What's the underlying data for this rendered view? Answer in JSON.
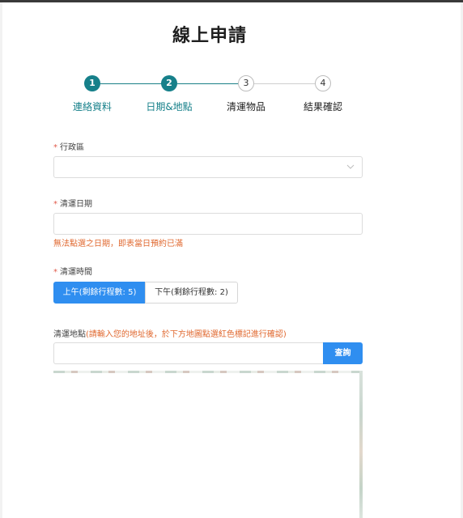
{
  "page": {
    "title": "線上申請"
  },
  "steps": [
    {
      "num": "1",
      "label": "連絡資料",
      "state": "done"
    },
    {
      "num": "2",
      "label": "日期&地點",
      "state": "done"
    },
    {
      "num": "3",
      "label": "清運物品",
      "state": "todo"
    },
    {
      "num": "4",
      "label": "結果確認",
      "state": "todo"
    }
  ],
  "form": {
    "district": {
      "label": "行政區",
      "required_mark": "*",
      "value": ""
    },
    "date": {
      "label": "清運日期",
      "required_mark": "*",
      "value": "",
      "error": "無法點選之日期，即表當日預約已滿"
    },
    "time": {
      "label": "清運時間",
      "required_mark": "*",
      "options": [
        {
          "label": "上午(剩餘行程數: 5)",
          "selected": true
        },
        {
          "label": "下午(剩餘行程數: 2)",
          "selected": false
        }
      ]
    },
    "address": {
      "label": "清運地點",
      "hint": "(請輸入您的地址後，於下方地圖點選紅色標記進行確認)",
      "value": "",
      "search_label": "查詢"
    }
  },
  "colors": {
    "teal": "#16808a",
    "blue": "#2f8ef0",
    "error": "#e0682f",
    "required": "#e15a4a"
  },
  "icons": {
    "select": "chevron-down-icon"
  }
}
